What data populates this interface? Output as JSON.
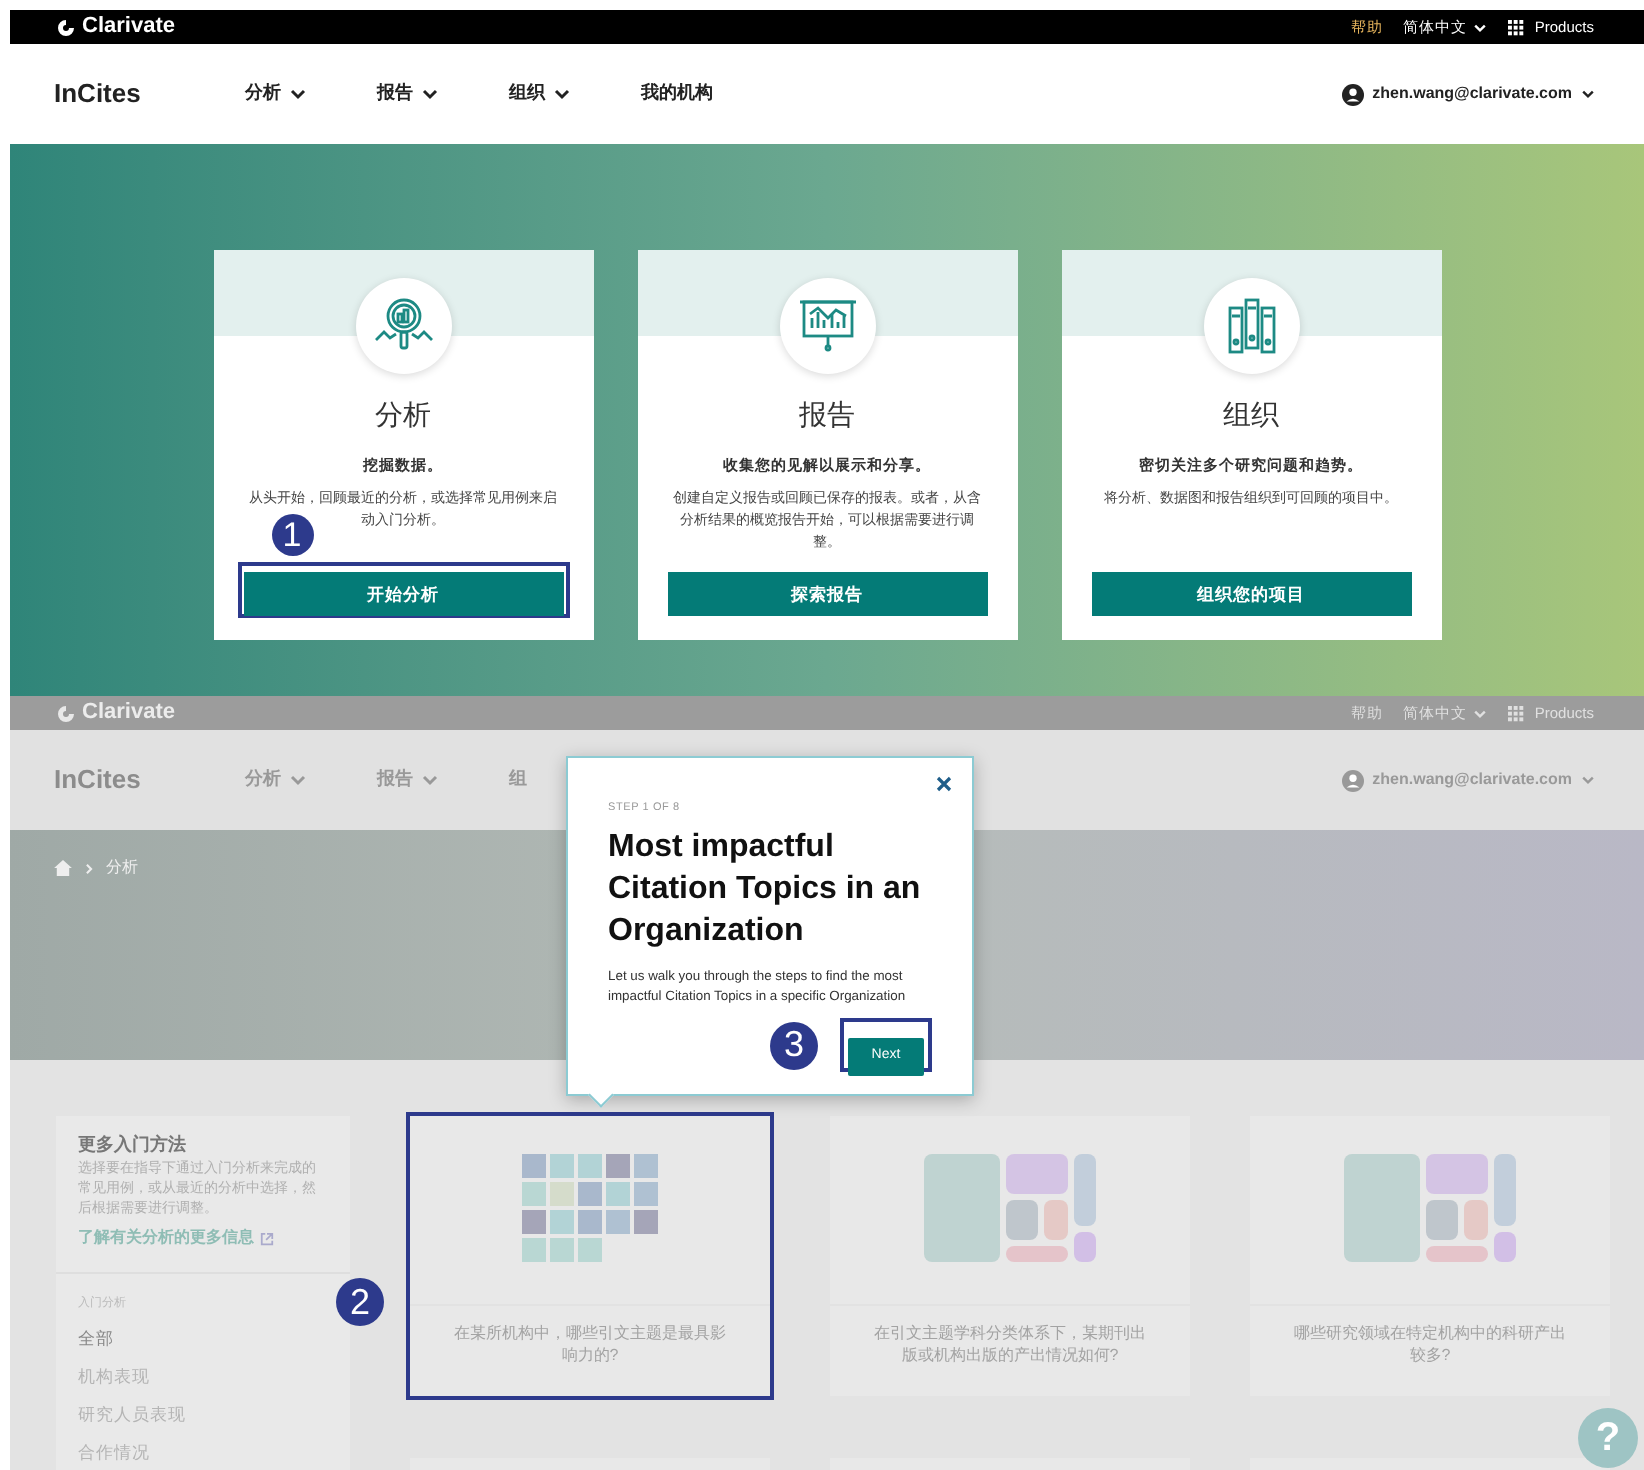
{
  "top_screen": {
    "top_bar": {
      "logo": "Clarivate",
      "help": "帮助",
      "language": "简体中文",
      "products": "Products"
    },
    "nav": {
      "brand": "InCites",
      "items": [
        {
          "label": "分析",
          "dropdown": true
        },
        {
          "label": "报告",
          "dropdown": true
        },
        {
          "label": "组织",
          "dropdown": true
        },
        {
          "label": "我的机构",
          "dropdown": false
        }
      ],
      "user": "zhen.wang@clarivate.com"
    },
    "cards": [
      {
        "kind": "analysis",
        "title": "分析",
        "subtitle": "挖掘数据。",
        "description": "从头开始，回顾最近的分析，或选择常见用例来启动入门分析。",
        "button": {
          "label": "开始分析",
          "highlighted": true,
          "callout": "1"
        }
      },
      {
        "kind": "reports",
        "title": "报告",
        "subtitle": "收集您的见解以展示和分享。",
        "description": "创建自定义报告或回顾已保存的报表。或者，从含分析结果的概览报告开始，可以根据需要进行调整。",
        "button": {
          "label": "探索报告",
          "highlighted": false
        }
      },
      {
        "kind": "organization",
        "title": "组织",
        "subtitle": "密切关注多个研究问题和趋势。",
        "description": "将分析、数据图和报告组织到可回顾的项目中。",
        "button": {
          "label": "组织您的项目",
          "highlighted": false
        }
      }
    ]
  },
  "bottom_screen": {
    "top_bar": {
      "logo": "Clarivate",
      "help": "帮助",
      "language": "简体中文",
      "products": "Products"
    },
    "nav": {
      "brand": "InCites",
      "items": [
        {
          "label": "分析",
          "dropdown": true
        },
        {
          "label": "报告",
          "dropdown": true
        },
        {
          "label": "组",
          "dropdown": false
        }
      ],
      "user": "zhen.wang@clarivate.com"
    },
    "breadcrumb": [
      "分析"
    ],
    "side_panel": {
      "title": "更多入门方法",
      "description": "选择要在指导下通过入门分析来完成的常见用例，或从最近的分析中选择，然后根据需要进行调整。",
      "link": "了解有关分析的更多信息",
      "section_label": "入门分析",
      "items": [
        {
          "label": "全部",
          "selected": true
        },
        {
          "label": "机构表现",
          "selected": false
        },
        {
          "label": "研究人员表现",
          "selected": false
        },
        {
          "label": "合作情况",
          "selected": false
        }
      ]
    },
    "cards": [
      {
        "kind": "grid",
        "caption": "在某所机构中，哪些引文主题是最具影响力的?",
        "highlighted": true,
        "callout": "2"
      },
      {
        "kind": "treemap",
        "caption": "在引文主题学科分类体系下，某期刊出版或机构出版的产出情况如何?",
        "highlighted": false
      },
      {
        "kind": "treemap",
        "caption": "哪些研究领域在特定机构中的科研产出较多?",
        "highlighted": false
      }
    ],
    "popover": {
      "step": "STEP 1 OF 8",
      "title": "Most impactful Citation Topics in an Organization",
      "body": "Let us walk you through the steps to find the most impactful Citation Topics in a specific Organization",
      "button": {
        "label": "Next",
        "highlighted": true,
        "callout": "3"
      }
    },
    "help_button": "?"
  }
}
